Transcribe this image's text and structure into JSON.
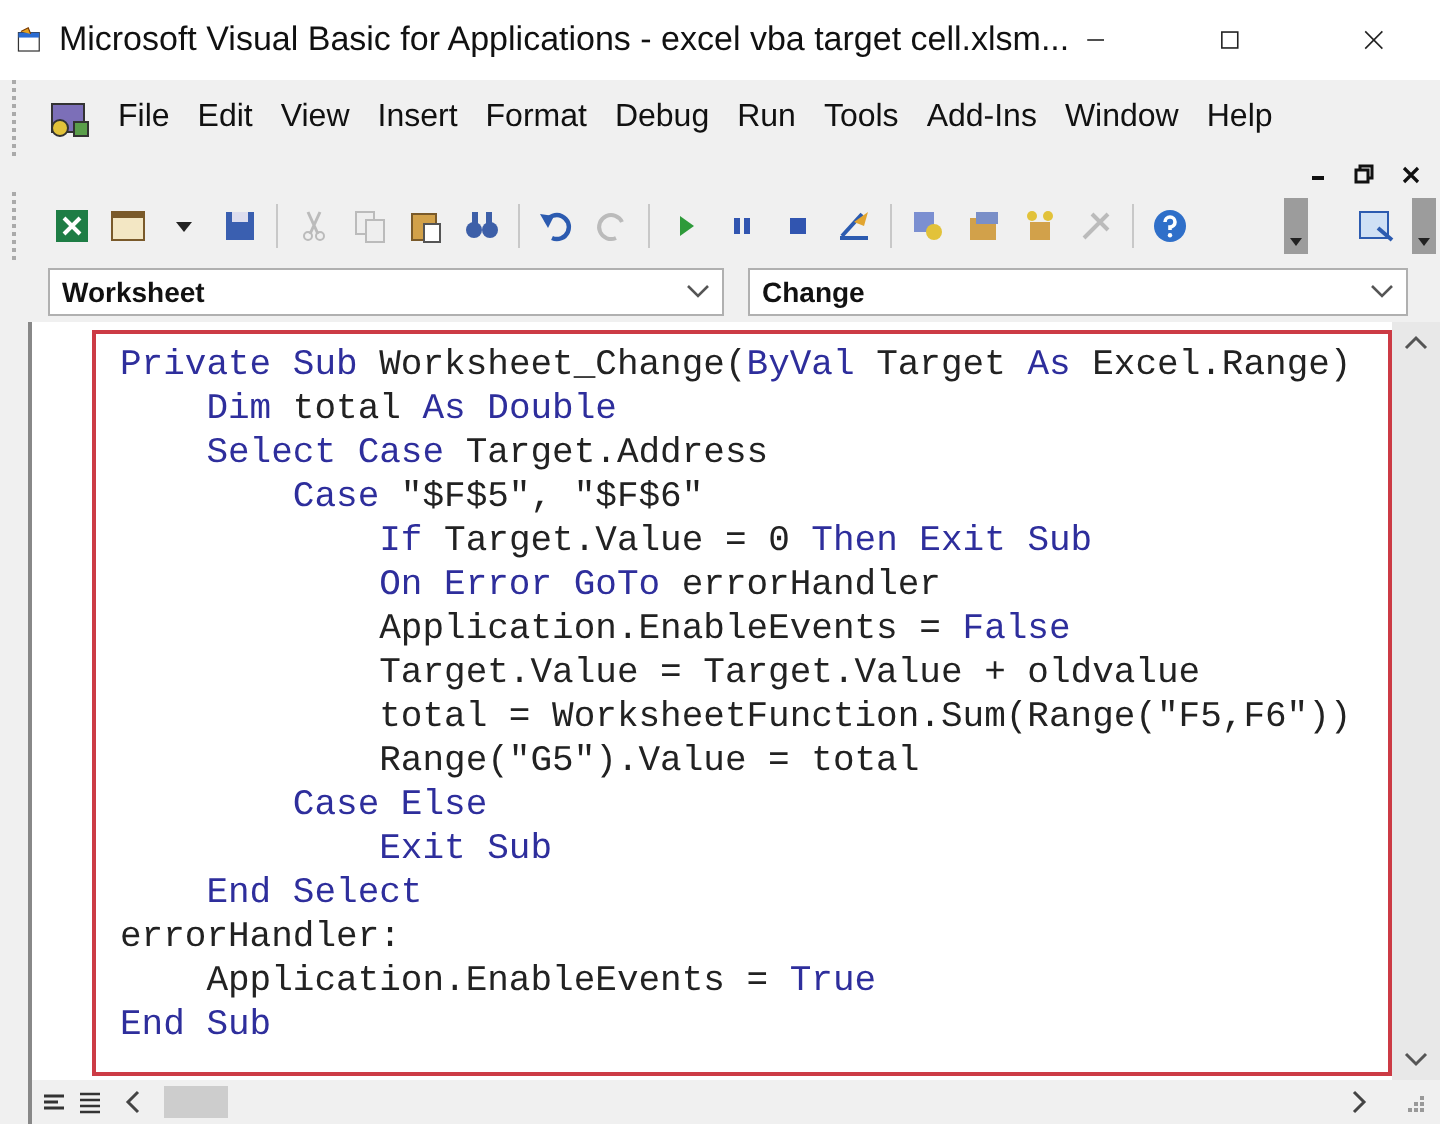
{
  "window": {
    "title": "Microsoft Visual Basic for Applications - excel vba target cell.xlsm..."
  },
  "menu": [
    "File",
    "Edit",
    "View",
    "Insert",
    "Format",
    "Debug",
    "Run",
    "Tools",
    "Add-Ins",
    "Window",
    "Help"
  ],
  "object_dropdown": {
    "value": "Worksheet"
  },
  "procedure_dropdown": {
    "value": "Change"
  },
  "code_lines": [
    [
      {
        "kind": "keyword",
        "text": "Private Sub"
      },
      {
        "kind": "plain",
        "text": " Worksheet_Change("
      },
      {
        "kind": "keyword",
        "text": "ByVal"
      },
      {
        "kind": "plain",
        "text": " Target "
      },
      {
        "kind": "keyword",
        "text": "As"
      },
      {
        "kind": "plain",
        "text": " Excel.Range)"
      }
    ],
    [
      {
        "kind": "keyword",
        "text": "    Dim"
      },
      {
        "kind": "plain",
        "text": " total "
      },
      {
        "kind": "keyword",
        "text": "As Double"
      }
    ],
    [
      {
        "kind": "keyword",
        "text": "    Select Case"
      },
      {
        "kind": "plain",
        "text": " Target.Address"
      }
    ],
    [
      {
        "kind": "keyword",
        "text": "        Case"
      },
      {
        "kind": "plain",
        "text": " \"$F$5\", \"$F$6\""
      }
    ],
    [
      {
        "kind": "keyword",
        "text": "            If"
      },
      {
        "kind": "plain",
        "text": " Target.Value = 0 "
      },
      {
        "kind": "keyword",
        "text": "Then Exit Sub"
      }
    ],
    [
      {
        "kind": "keyword",
        "text": "            On Error GoTo"
      },
      {
        "kind": "plain",
        "text": " errorHandler"
      }
    ],
    [
      {
        "kind": "plain",
        "text": "            Application.EnableEvents = "
      },
      {
        "kind": "keyword",
        "text": "False"
      }
    ],
    [
      {
        "kind": "plain",
        "text": "            Target.Value = Target.Value + oldvalue"
      }
    ],
    [
      {
        "kind": "plain",
        "text": "            total = WorksheetFunction.Sum(Range(\"F5,F6\"))"
      }
    ],
    [
      {
        "kind": "plain",
        "text": "            Range(\"G5\").Value = total"
      }
    ],
    [
      {
        "kind": "keyword",
        "text": "        Case Else"
      }
    ],
    [
      {
        "kind": "keyword",
        "text": "            Exit Sub"
      }
    ],
    [
      {
        "kind": "keyword",
        "text": "    End Select"
      }
    ],
    [
      {
        "kind": "plain",
        "text": "errorHandler:"
      }
    ],
    [
      {
        "kind": "plain",
        "text": "    Application.EnableEvents = "
      },
      {
        "kind": "keyword",
        "text": "True"
      }
    ],
    [
      {
        "kind": "keyword",
        "text": "End Sub"
      }
    ]
  ]
}
